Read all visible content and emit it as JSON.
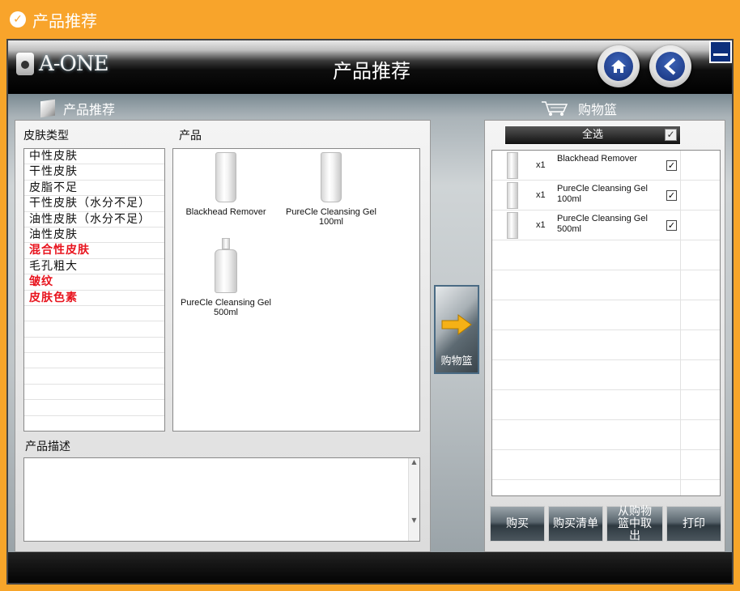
{
  "window": {
    "title": "产品推荐"
  },
  "header": {
    "brand": "A-ONE",
    "title": "产品推荐"
  },
  "icons": {
    "home": "home-icon",
    "back": "chevron-left-icon",
    "minimize": "minimize-icon",
    "cart": "shopping-cart-icon",
    "box": "box-icon",
    "arrow": "arrow-right-icon"
  },
  "sections": {
    "left_label": "产品推荐",
    "right_label": "购物篮"
  },
  "left": {
    "skin_type_label": "皮肤类型",
    "product_label": "产品",
    "skin_types": [
      {
        "label": "中性皮肤",
        "highlight": false
      },
      {
        "label": "干性皮肤",
        "highlight": false
      },
      {
        "label": "皮脂不足",
        "highlight": false
      },
      {
        "label": "干性皮肤（水分不足）",
        "highlight": false
      },
      {
        "label": "油性皮肤（水分不足）",
        "highlight": false
      },
      {
        "label": "油性皮肤",
        "highlight": false
      },
      {
        "label": "混合性皮肤",
        "highlight": true
      },
      {
        "label": "毛孔粗大",
        "highlight": false
      },
      {
        "label": "皱纹",
        "highlight": true
      },
      {
        "label": "皮肤色素",
        "highlight": true
      }
    ],
    "products": [
      {
        "name": "Blackhead Remover"
      },
      {
        "name": "PureCle Cleansing Gel 100ml"
      },
      {
        "name": "PureCle Cleansing Gel 500ml"
      }
    ],
    "desc_label": "产品描述",
    "desc_text": ""
  },
  "add_button": {
    "label": "购物篮"
  },
  "cart": {
    "select_all_label": "全选",
    "select_all_checked": true,
    "items": [
      {
        "qty": "x1",
        "name": "Blackhead Remover",
        "checked": true
      },
      {
        "qty": "x1",
        "name": "PureCle Cleansing Gel 100ml",
        "checked": true
      },
      {
        "qty": "x1",
        "name": "PureCle Cleansing Gel 500ml",
        "checked": true
      }
    ],
    "buttons": {
      "buy": "购买",
      "buy_list": "购买清单",
      "remove": "从购物篮中取出",
      "print": "打印"
    }
  },
  "colors": {
    "accent": "#f8a42b",
    "highlight": "#e8141e",
    "button_blue": "#15307a"
  }
}
